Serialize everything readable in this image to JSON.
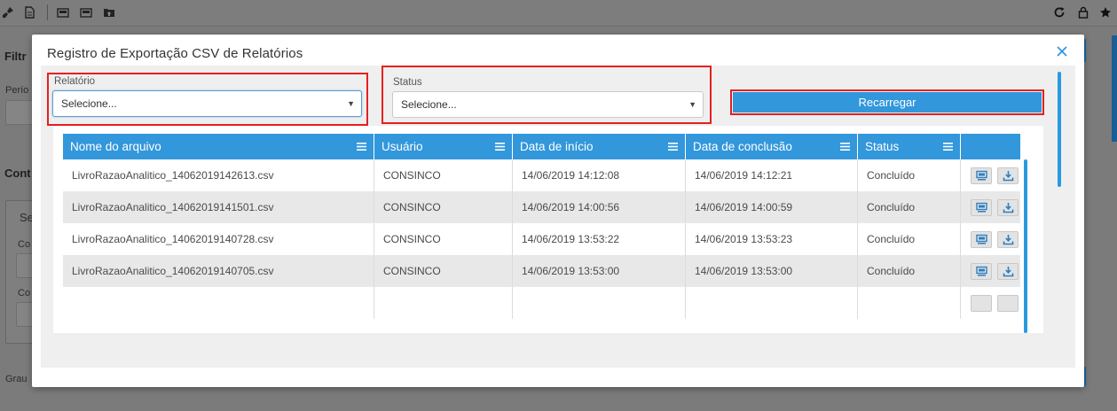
{
  "background": {
    "toolbar_icons": [
      "broom-icon",
      "document-icon",
      "csv-icon",
      "pdf-icon",
      "folder-upload-icon"
    ],
    "right_icons": [
      "refresh-icon",
      "lock-icon",
      "star-icon"
    ],
    "filter_heading": "Filtr",
    "period_label": "Perío",
    "cont_heading": "Cont",
    "se_label": "Se",
    "co_label_1": "Co",
    "co_label_2": "Co",
    "grau_label": "Grau"
  },
  "modal": {
    "title": "Registro de Exportação CSV de Relatórios",
    "close_icon": "close-icon"
  },
  "filters": {
    "relatorio": {
      "label": "Relatório",
      "value": "Selecione..."
    },
    "status": {
      "label": "Status",
      "value": "Selecione..."
    },
    "reload_label": "Recarregar"
  },
  "grid": {
    "columns": [
      {
        "label": "Nome do arquivo"
      },
      {
        "label": "Usuário"
      },
      {
        "label": "Data de início"
      },
      {
        "label": "Data de conclusão"
      },
      {
        "label": "Status"
      },
      {
        "label": ""
      }
    ],
    "rows": [
      {
        "file": "LivroRazaoAnalitico_14062019142613.csv",
        "user": "CONSINCO",
        "start": "14/06/2019 14:12:08",
        "end": "14/06/2019 14:12:21",
        "status": "Concluído"
      },
      {
        "file": "LivroRazaoAnalitico_14062019141501.csv",
        "user": "CONSINCO",
        "start": "14/06/2019 14:00:56",
        "end": "14/06/2019 14:00:59",
        "status": "Concluído"
      },
      {
        "file": "LivroRazaoAnalitico_14062019140728.csv",
        "user": "CONSINCO",
        "start": "14/06/2019 13:53:22",
        "end": "14/06/2019 13:53:23",
        "status": "Concluído"
      },
      {
        "file": "LivroRazaoAnalitico_14062019140705.csv",
        "user": "CONSINCO",
        "start": "14/06/2019 13:53:00",
        "end": "14/06/2019 13:53:00",
        "status": "Concluído"
      },
      {
        "file": "",
        "user": "",
        "start": "",
        "end": "",
        "status": ""
      }
    ],
    "row_actions": [
      "view-icon",
      "download-icon"
    ]
  },
  "colors": {
    "accent": "#3297db",
    "highlight_border": "#e4201f",
    "overlay": "#7b7b7b"
  }
}
